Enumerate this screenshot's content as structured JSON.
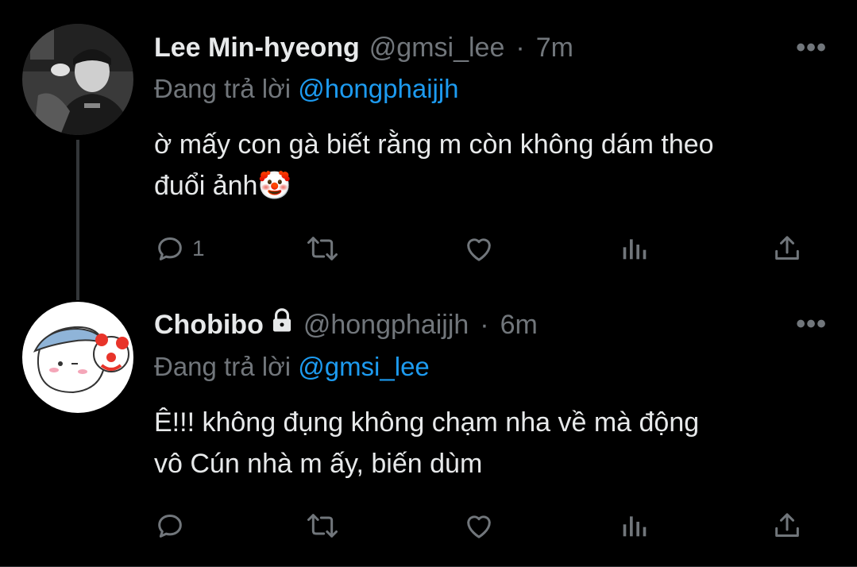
{
  "tweets": [
    {
      "name": "Lee Min-hyeong",
      "handle": "@gmsi_lee",
      "separator": "·",
      "time": "7m",
      "replying_prefix": "Đang trả lời",
      "replying_to": "@hongphaijjh",
      "text_line1": "ờ mấy con gà biết rằng m còn không dám theo",
      "text_line2": "đuổi ảnh🤡",
      "reply_count": "1",
      "more": "•••",
      "protected": false
    },
    {
      "name": "Chobibo",
      "handle": "@hongphaijjh",
      "separator": "·",
      "time": "6m",
      "replying_prefix": "Đang trả lời",
      "replying_to": "@gmsi_lee",
      "text_line1": "Ê!!! không đụng không chạm nha về mà động",
      "text_line2": "vô Cún nhà m ấy, biến dùm",
      "reply_count": "",
      "more": "•••",
      "protected": true
    }
  ],
  "icons": [
    "reply-icon",
    "retweet-icon",
    "like-icon",
    "views-icon",
    "share-icon",
    "lock-icon"
  ],
  "colors": {
    "background": "#000000",
    "text": "#e7e9ea",
    "muted": "#71767b",
    "link": "#1d9bf0",
    "thread_line": "#333639"
  }
}
